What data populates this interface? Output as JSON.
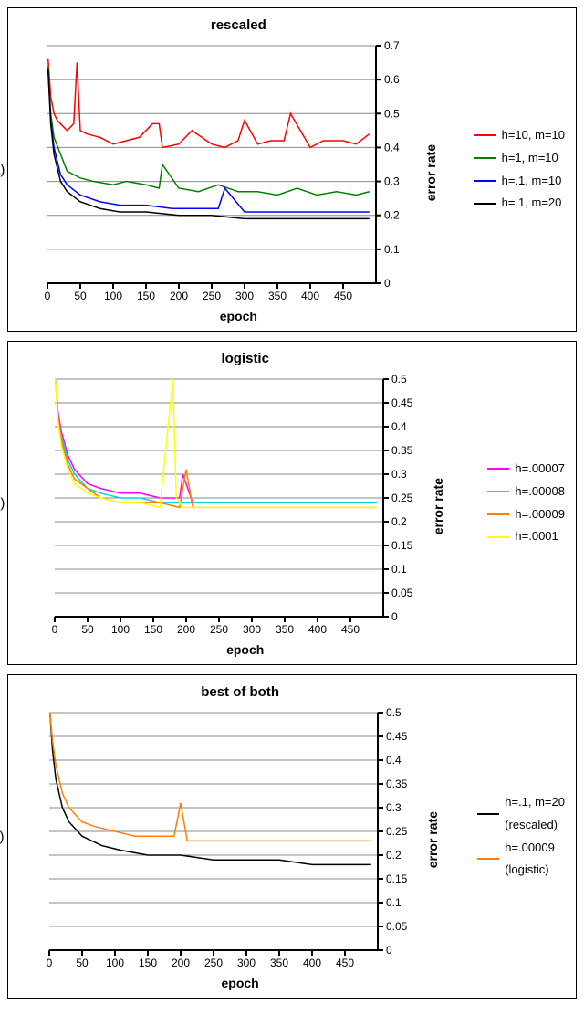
{
  "chart_data": [
    {
      "id": "a",
      "panel_label": "(a)",
      "title": "rescaled",
      "xlabel": "epoch",
      "ylabel": "error rate",
      "type": "line",
      "xlim": [
        0,
        500
      ],
      "ylim": [
        0,
        0.7
      ],
      "xticks": [
        0,
        50,
        100,
        150,
        200,
        250,
        300,
        350,
        400,
        450
      ],
      "yticks": [
        0,
        0.1,
        0.2,
        0.3,
        0.4,
        0.5,
        0.6,
        0.7
      ],
      "series": [
        {
          "name": "h=10, m=10",
          "color": "#ff0000",
          "x": [
            1,
            5,
            10,
            15,
            20,
            30,
            40,
            45,
            50,
            60,
            80,
            100,
            120,
            140,
            160,
            170,
            175,
            200,
            220,
            250,
            270,
            290,
            300,
            320,
            340,
            360,
            370,
            400,
            420,
            450,
            470,
            490
          ],
          "y": [
            0.66,
            0.55,
            0.5,
            0.48,
            0.47,
            0.45,
            0.47,
            0.65,
            0.45,
            0.44,
            0.43,
            0.41,
            0.42,
            0.43,
            0.47,
            0.47,
            0.4,
            0.41,
            0.45,
            0.41,
            0.4,
            0.42,
            0.48,
            0.41,
            0.42,
            0.42,
            0.5,
            0.4,
            0.42,
            0.42,
            0.41,
            0.44
          ]
        },
        {
          "name": "h=1, m=10",
          "color": "#008000",
          "x": [
            1,
            5,
            10,
            20,
            30,
            50,
            70,
            100,
            120,
            150,
            170,
            175,
            200,
            230,
            260,
            290,
            320,
            350,
            380,
            410,
            440,
            470,
            490
          ],
          "y": [
            0.64,
            0.5,
            0.43,
            0.38,
            0.33,
            0.31,
            0.3,
            0.29,
            0.3,
            0.29,
            0.28,
            0.35,
            0.28,
            0.27,
            0.29,
            0.27,
            0.27,
            0.26,
            0.28,
            0.26,
            0.27,
            0.26,
            0.27
          ]
        },
        {
          "name": "h=.1, m=10",
          "color": "#0000ff",
          "x": [
            1,
            5,
            10,
            20,
            30,
            50,
            80,
            110,
            150,
            190,
            230,
            260,
            270,
            300,
            350,
            400,
            450,
            490
          ],
          "y": [
            0.63,
            0.48,
            0.4,
            0.32,
            0.29,
            0.26,
            0.24,
            0.23,
            0.23,
            0.22,
            0.22,
            0.22,
            0.28,
            0.21,
            0.21,
            0.21,
            0.21,
            0.21
          ]
        },
        {
          "name": "h=.1, m=20",
          "color": "#000000",
          "x": [
            1,
            5,
            10,
            20,
            30,
            50,
            80,
            110,
            150,
            200,
            250,
            300,
            350,
            400,
            450,
            490
          ],
          "y": [
            0.63,
            0.47,
            0.38,
            0.3,
            0.27,
            0.24,
            0.22,
            0.21,
            0.21,
            0.2,
            0.2,
            0.19,
            0.19,
            0.19,
            0.19,
            0.19
          ]
        }
      ]
    },
    {
      "id": "b",
      "panel_label": "(b)",
      "title": "logistic",
      "xlabel": "epoch",
      "ylabel": "error rate",
      "type": "line",
      "xlim": [
        0,
        500
      ],
      "ylim": [
        0,
        0.5
      ],
      "xticks": [
        0,
        50,
        100,
        150,
        200,
        250,
        300,
        350,
        400,
        450
      ],
      "yticks": [
        0,
        0.05,
        0.1,
        0.15,
        0.2,
        0.25,
        0.3,
        0.35,
        0.4,
        0.45,
        0.5
      ],
      "series": [
        {
          "name": "h=.00007",
          "color": "#ff00ff",
          "x": [
            1,
            5,
            10,
            20,
            30,
            50,
            70,
            100,
            130,
            160,
            190,
            195,
            210,
            250,
            300,
            350,
            400,
            450,
            490
          ],
          "y": [
            0.5,
            0.43,
            0.39,
            0.34,
            0.31,
            0.28,
            0.27,
            0.26,
            0.26,
            0.25,
            0.25,
            0.3,
            0.24,
            0.24,
            0.24,
            0.24,
            0.24,
            0.24,
            0.24
          ]
        },
        {
          "name": "h=.00008",
          "color": "#00d8d8",
          "x": [
            1,
            5,
            10,
            20,
            30,
            50,
            70,
            100,
            130,
            160,
            190,
            210,
            250,
            300,
            350,
            400,
            450,
            490
          ],
          "y": [
            0.5,
            0.42,
            0.38,
            0.33,
            0.3,
            0.27,
            0.26,
            0.25,
            0.25,
            0.24,
            0.24,
            0.24,
            0.24,
            0.24,
            0.24,
            0.24,
            0.24,
            0.24
          ]
        },
        {
          "name": "h=.00009",
          "color": "#ff8000",
          "x": [
            1,
            5,
            10,
            20,
            30,
            50,
            70,
            100,
            130,
            160,
            190,
            200,
            210,
            230,
            260,
            300,
            350,
            400,
            450,
            490
          ],
          "y": [
            0.5,
            0.42,
            0.37,
            0.32,
            0.29,
            0.27,
            0.25,
            0.24,
            0.24,
            0.24,
            0.23,
            0.31,
            0.23,
            0.23,
            0.23,
            0.23,
            0.23,
            0.23,
            0.23,
            0.23
          ]
        },
        {
          "name": "h=.0001",
          "color": "#ffff00",
          "x": [
            1,
            5,
            10,
            20,
            30,
            50,
            70,
            100,
            130,
            160,
            180,
            185,
            195,
            220,
            250,
            300,
            350,
            400,
            450,
            490
          ],
          "y": [
            0.5,
            0.41,
            0.36,
            0.31,
            0.28,
            0.26,
            0.25,
            0.24,
            0.24,
            0.23,
            0.5,
            0.25,
            0.23,
            0.23,
            0.23,
            0.23,
            0.23,
            0.23,
            0.23,
            0.23
          ]
        }
      ]
    },
    {
      "id": "c",
      "panel_label": "(c)",
      "title": "best of both",
      "xlabel": "epoch",
      "ylabel": "error rate",
      "type": "line",
      "xlim": [
        0,
        500
      ],
      "ylim": [
        0,
        0.5
      ],
      "xticks": [
        0,
        50,
        100,
        150,
        200,
        250,
        300,
        350,
        400,
        450
      ],
      "yticks": [
        0,
        0.05,
        0.1,
        0.15,
        0.2,
        0.25,
        0.3,
        0.35,
        0.4,
        0.45,
        0.5
      ],
      "series": [
        {
          "name": "h=.1, m=20 (rescaled)",
          "color": "#000000",
          "x": [
            1,
            5,
            10,
            20,
            30,
            50,
            80,
            110,
            150,
            200,
            250,
            300,
            350,
            400,
            450,
            490
          ],
          "y": [
            0.5,
            0.42,
            0.36,
            0.3,
            0.27,
            0.24,
            0.22,
            0.21,
            0.2,
            0.2,
            0.19,
            0.19,
            0.19,
            0.18,
            0.18,
            0.18
          ]
        },
        {
          "name": "h=.00009 (logistic)",
          "color": "#ff8000",
          "x": [
            1,
            5,
            10,
            20,
            30,
            50,
            70,
            100,
            130,
            160,
            190,
            200,
            210,
            230,
            260,
            300,
            350,
            400,
            450,
            490
          ],
          "y": [
            0.5,
            0.44,
            0.39,
            0.33,
            0.3,
            0.27,
            0.26,
            0.25,
            0.24,
            0.24,
            0.24,
            0.31,
            0.23,
            0.23,
            0.23,
            0.23,
            0.23,
            0.23,
            0.23,
            0.23
          ]
        }
      ]
    }
  ]
}
